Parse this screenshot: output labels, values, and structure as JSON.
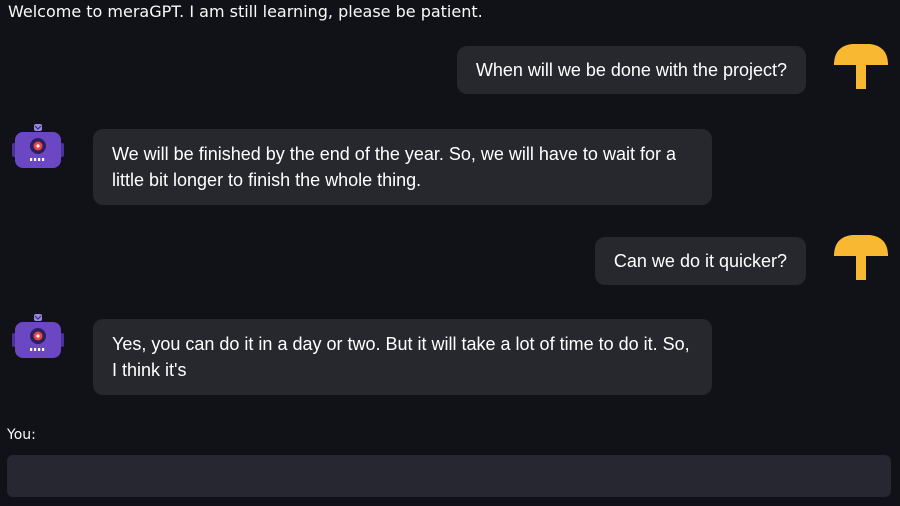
{
  "header": {
    "welcome_text": "Welcome to meraGPT. I am still learning, please be patient."
  },
  "messages": [
    {
      "role": "user",
      "avatar_icon": "user-avatar-icon",
      "text": "When will we be done with the project?"
    },
    {
      "role": "bot",
      "avatar_icon": "bot-avatar-icon",
      "text": "We will be finished by the end of the year. So, we will have to wait for a little bit longer to finish the whole thing."
    },
    {
      "role": "user",
      "avatar_icon": "user-avatar-icon",
      "text": "Can we do it quicker?"
    },
    {
      "role": "bot",
      "avatar_icon": "bot-avatar-icon",
      "text": "Yes, you can do it in a day or two. But it will take a lot of time to do it. So, I think it's"
    }
  ],
  "input": {
    "label": "You:",
    "value": "",
    "placeholder": ""
  },
  "colors": {
    "background": "#111217",
    "bubble": "#27282e",
    "input": "#262730",
    "user_avatar": "#f9b832",
    "bot_avatar": "#6b47c4"
  }
}
